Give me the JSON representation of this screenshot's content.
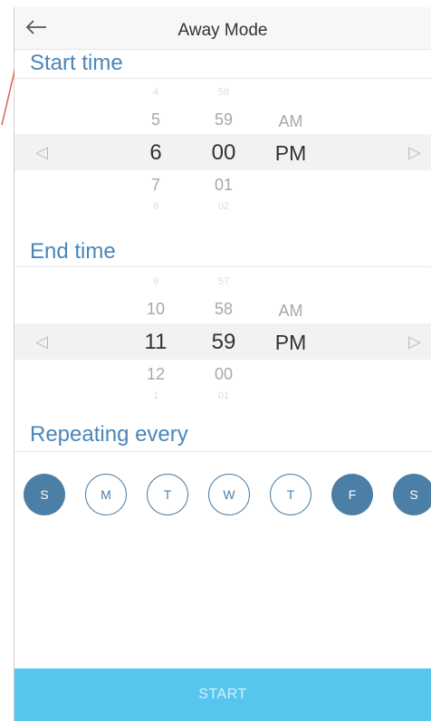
{
  "header": {
    "title": "Away Mode",
    "back_icon": "arrow-left-icon"
  },
  "start_time": {
    "heading": "Start time",
    "hours": [
      "4",
      "5",
      "6",
      "7",
      "8"
    ],
    "minutes": [
      "58",
      "59",
      "00",
      "01",
      "02"
    ],
    "periods": [
      "AM",
      "PM"
    ],
    "selected": {
      "hour": "6",
      "minute": "00",
      "period": "PM"
    }
  },
  "end_time": {
    "heading": "End time",
    "hours": [
      "9",
      "10",
      "11",
      "12",
      "1"
    ],
    "minutes": [
      "57",
      "58",
      "59",
      "00",
      "01"
    ],
    "periods": [
      "AM",
      "PM"
    ],
    "selected": {
      "hour": "11",
      "minute": "59",
      "period": "PM"
    }
  },
  "repeat": {
    "heading": "Repeating every",
    "days": [
      {
        "label": "S",
        "selected": true
      },
      {
        "label": "M",
        "selected": false
      },
      {
        "label": "T",
        "selected": false
      },
      {
        "label": "W",
        "selected": false
      },
      {
        "label": "T",
        "selected": false
      },
      {
        "label": "F",
        "selected": true
      },
      {
        "label": "S",
        "selected": true
      }
    ]
  },
  "actions": {
    "start_label": "START"
  },
  "colors": {
    "accent": "#4c7fa6",
    "heading": "#4a86b8",
    "button": "#56c6ef"
  }
}
